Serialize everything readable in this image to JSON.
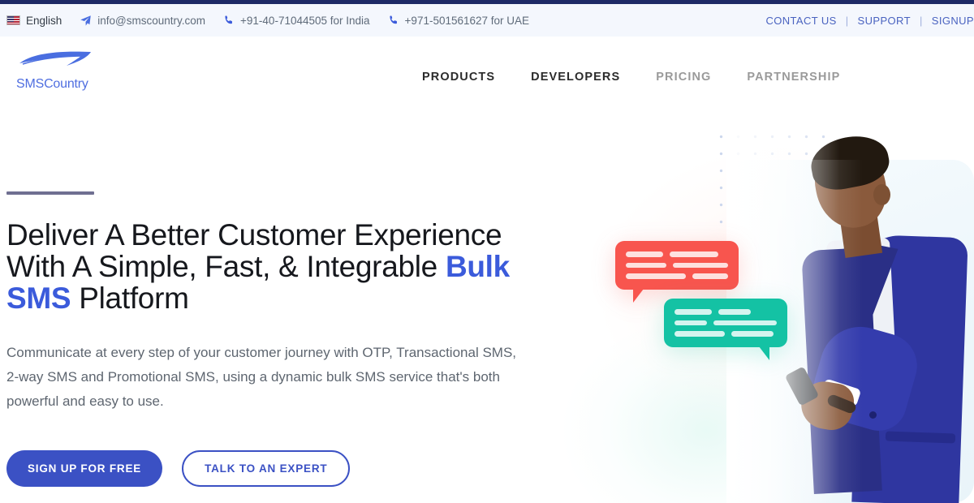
{
  "topbar": {
    "language": {
      "label": "English",
      "icon": "us-flag-icon"
    },
    "email": {
      "label": "info@smscountry.com",
      "icon": "paper-plane-icon"
    },
    "phone_india": {
      "label": "+91-40-71044505 for India",
      "icon": "phone-icon"
    },
    "phone_uae": {
      "label": "+971-501561627 for UAE",
      "icon": "phone-icon"
    },
    "links": [
      {
        "label": "CONTACT US"
      },
      {
        "label": "SUPPORT"
      },
      {
        "label": "SIGNUP"
      }
    ],
    "separator": "|",
    "background": "#f4f7fd",
    "link_color": "#4a63c0",
    "strip_color": "#1e2a66"
  },
  "header": {
    "logo": {
      "text": "SMSCountry",
      "icon": "smscountry-swoosh-logo",
      "color": "#4f6ee0"
    },
    "nav": [
      {
        "label": "PRODUCTS",
        "state": "active"
      },
      {
        "label": "DEVELOPERS",
        "state": "active"
      },
      {
        "label": "PRICING",
        "state": "muted"
      },
      {
        "label": "PARTNERSHIP",
        "state": "muted"
      }
    ]
  },
  "hero": {
    "accent_rule_color": "#6f6f91",
    "headline": {
      "part1": "Deliver A Better Customer Experience With A Simple, Fast, & Integrable ",
      "highlight": "Bulk SMS",
      "part2": " Platform",
      "highlight_color": "#3b5bdb"
    },
    "subcopy": "Communicate at every step of your customer journey with OTP, Transactional SMS, 2-way SMS and Promotional SMS, using a dynamic bulk SMS service that's both powerful and easy to use.",
    "buttons": {
      "primary": {
        "label": "SIGN UP FOR FREE",
        "bg": "#3b51c4",
        "fg": "#ffffff"
      },
      "secondary": {
        "label": "TALK TO AN EXPERT",
        "fg": "#3b51c4",
        "border": "#3b51c4"
      }
    },
    "artwork": {
      "dot_grid_color": "#c3d0ea",
      "bubble_red_color": "#f8554e",
      "bubble_teal_color": "#14c2a4",
      "photo_description": "man-in-blue-suit-using-phone"
    }
  }
}
